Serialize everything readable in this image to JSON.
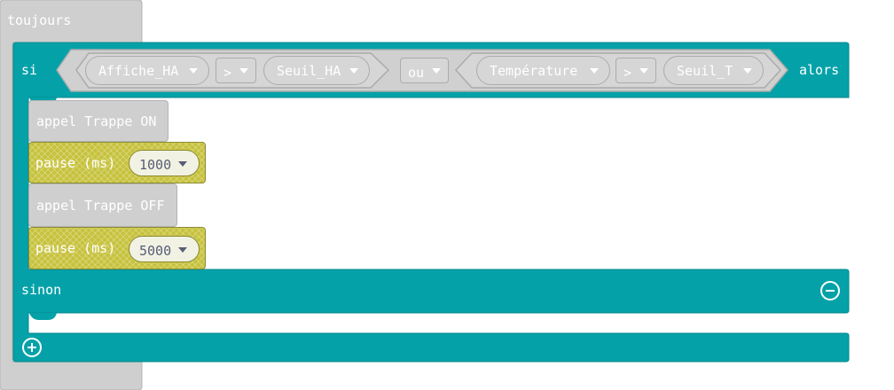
{
  "forever_block": {
    "label": "toujours"
  },
  "if_block": {
    "if_label": "si",
    "then_label": "alors",
    "else_label": "sinon",
    "condition": {
      "left": {
        "left_operand": "Affiche_HA",
        "operator": ">",
        "right_operand": "Seuil_HA"
      },
      "logic_operator": "ou",
      "right": {
        "left_operand": "Température",
        "operator": ">",
        "right_operand": "Seuil_T"
      }
    }
  },
  "body": [
    {
      "type": "call",
      "label": "appel Trappe ON"
    },
    {
      "type": "pause",
      "label": "pause (ms)",
      "value": "1000"
    },
    {
      "type": "call",
      "label": "appel Trappe OFF"
    },
    {
      "type": "pause",
      "label": "pause (ms)",
      "value": "5000"
    }
  ],
  "icons": {
    "remove": "minus-circle-icon",
    "add": "plus-circle-icon",
    "dropdown": "caret-down-icon"
  },
  "colors": {
    "logic": "#04A2A8",
    "block_gray": "#CFCFCF",
    "pause": "#C7C23D",
    "value_bg": "#F2F2E4"
  }
}
